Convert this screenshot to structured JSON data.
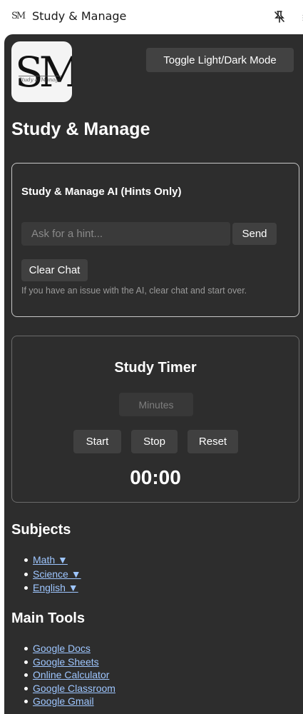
{
  "window": {
    "title": "Study & Manage",
    "app_icon_text": "SM",
    "icons": [
      "app-logo-icon",
      "unpin-icon",
      "more-icon"
    ]
  },
  "header": {
    "logo_letters": "SM",
    "logo_script": "Study & Manage",
    "toggle_label": "Toggle Light/Dark Mode"
  },
  "page": {
    "title": "Study & Manage"
  },
  "ai": {
    "title": "Study & Manage AI (Hints Only)",
    "input_placeholder": "Ask for a hint...",
    "input_value": "",
    "send_label": "Send",
    "clear_label": "Clear Chat",
    "note": "If you have an issue with the AI, clear chat and start over."
  },
  "timer": {
    "title": "Study Timer",
    "minutes_placeholder": "Minutes",
    "minutes_value": "",
    "start_label": "Start",
    "stop_label": "Stop",
    "reset_label": "Reset",
    "display": "00:00"
  },
  "subjects": {
    "heading": "Subjects",
    "items": [
      "Math ▼",
      "Science ▼",
      "English ▼"
    ]
  },
  "tools": {
    "heading": "Main Tools",
    "items": [
      "Google Docs",
      "Google Sheets",
      "Online Calculator",
      "Google Classroom",
      "Google Gmail"
    ]
  },
  "colors": {
    "panel_bg": "#2d2d2d",
    "button_bg": "#404040",
    "link": "#9ec6ff",
    "text": "#ffffff",
    "muted": "#9a9a9a"
  }
}
